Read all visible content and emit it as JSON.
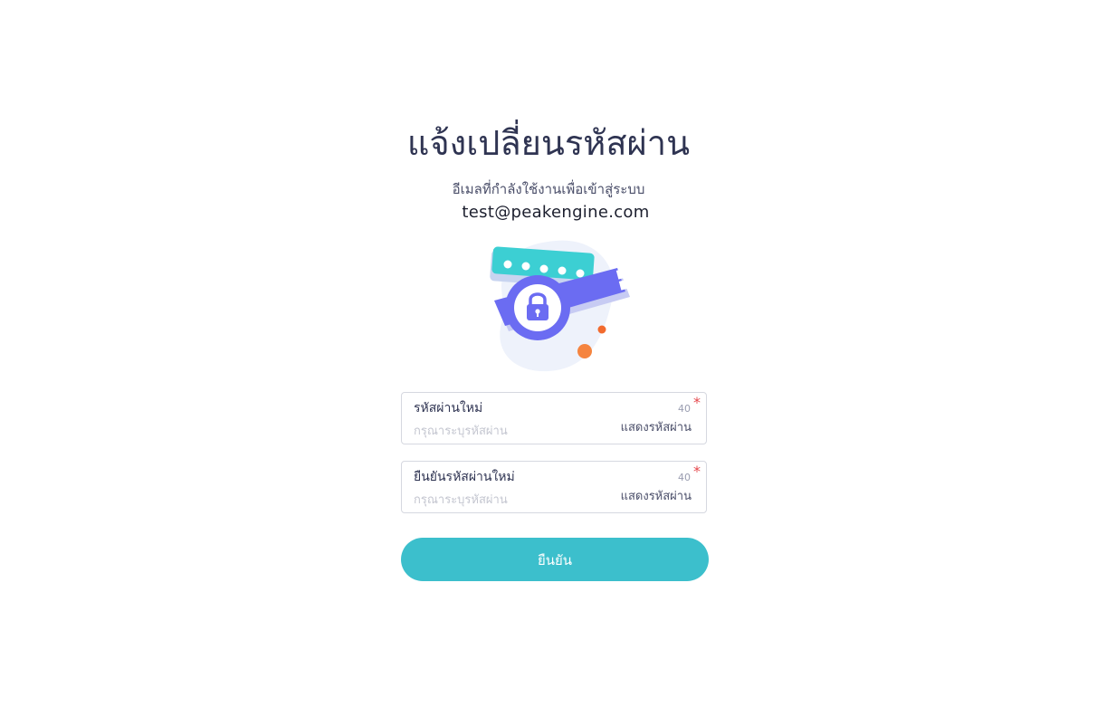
{
  "page": {
    "title": "แจ้งเปลี่ยนรหัสผ่าน",
    "subtitle": "อีเมลที่กำลังใช้งานเพื่อเข้าสู่ระบบ",
    "email": "test@peakengine.com"
  },
  "illustration": {
    "icon": "password-lock-illustration",
    "colors": {
      "teal": "#3ccfd3",
      "purple": "#6b6cf2",
      "orange": "#f5843f",
      "blob": "#eef2fb"
    }
  },
  "form": {
    "new_password": {
      "label": "รหัสผ่านใหม่",
      "max_length": "40",
      "required_mark": "*",
      "placeholder": "กรุณาระบุรหัสผ่าน",
      "toggle_label": "แสดงรหัสผ่าน"
    },
    "confirm_password": {
      "label": "ยืนยันรหัสผ่านใหม่",
      "max_length": "40",
      "required_mark": "*",
      "placeholder": "กรุณาระบุรหัสผ่าน",
      "toggle_label": "แสดงรหัสผ่าน"
    },
    "submit_label": "ยืนยัน"
  },
  "colors": {
    "accent": "#3cbfcc",
    "title": "#2f3452",
    "required": "#e5484d"
  }
}
